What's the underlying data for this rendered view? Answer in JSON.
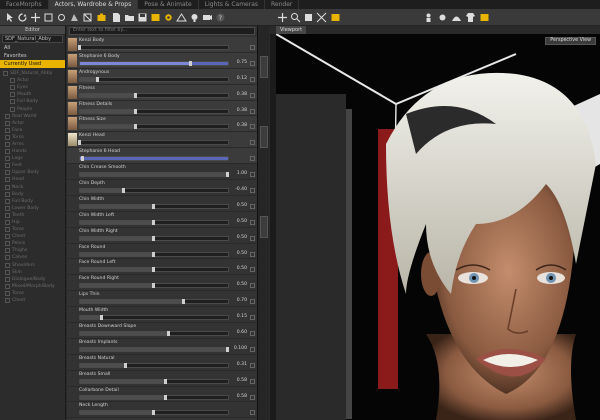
{
  "tabs": [
    "FaceMorphs",
    "Actors, Wardrobe & Props",
    "Pose & Animate",
    "Lights & Cameras",
    "Render"
  ],
  "active_tab": "Actors, Wardrobe & Props",
  "scene": {
    "header": "Editor",
    "selector": "SDF_Natural_Abby",
    "categories": [
      "All",
      "Favorites",
      "Currently Used"
    ],
    "selected_category": "Currently Used",
    "tree": [
      "SDF_Natural_Abby",
      "Actor",
      "Eyes",
      "Mouth",
      "Full Body",
      "People",
      "Real World",
      "Actor",
      "Face",
      "Torso",
      "Arms",
      "Hands",
      "Legs",
      "Feet",
      "Upper Body",
      "Head",
      "Neck",
      "Body",
      "Full Body",
      "Lower Body",
      "Teeth",
      "Hip",
      "Torso",
      "Chest",
      "Pelvis",
      "Thighs",
      "Calves",
      "Shoulders",
      "Skin",
      "Dialogue/Body",
      "Mixed/Morph/Body",
      "Torso",
      "Chest"
    ]
  },
  "params": {
    "search_placeholder": "Enter text to filter by...",
    "rows": [
      {
        "label": "Kenzi Body",
        "value": "",
        "fill": 0.0,
        "thumb": "brown",
        "highlight": false
      },
      {
        "label": "Stephanie 6 Body",
        "value": "0.75",
        "fill": 0.75,
        "thumb": "brown",
        "highlight": true
      },
      {
        "label": "Androgynous",
        "value": "0.12",
        "fill": 0.12,
        "thumb": "brown",
        "highlight": false
      },
      {
        "label": "Fitness",
        "value": "0.38",
        "fill": 0.38,
        "thumb": "brown",
        "highlight": false
      },
      {
        "label": "Fitness Details",
        "value": "0.38",
        "fill": 0.38,
        "thumb": "brown",
        "highlight": false
      },
      {
        "label": "Fitness Size",
        "value": "0.38",
        "fill": 0.38,
        "thumb": "brown",
        "highlight": false
      },
      {
        "label": "Kenzi Head",
        "value": "",
        "fill": 0.0,
        "thumb": "blond",
        "highlight": false
      },
      {
        "label": "Stephanie 6 Head",
        "value": "",
        "fill": 0.02,
        "thumb": "",
        "highlight": true
      },
      {
        "label": "Chin Crease Smooth",
        "value": "1.00",
        "fill": 1.0,
        "thumb": "",
        "highlight": false
      },
      {
        "label": "Chin Depth",
        "value": "-0.40",
        "fill": 0.3,
        "thumb": "",
        "highlight": false
      },
      {
        "label": "Chin Width",
        "value": "0.50",
        "fill": 0.5,
        "thumb": "",
        "highlight": false
      },
      {
        "label": "Chin Width Left",
        "value": "0.50",
        "fill": 0.5,
        "thumb": "",
        "highlight": false
      },
      {
        "label": "Chin Width Right",
        "value": "0.50",
        "fill": 0.5,
        "thumb": "",
        "highlight": false
      },
      {
        "label": "Face Round",
        "value": "0.50",
        "fill": 0.5,
        "thumb": "",
        "highlight": false
      },
      {
        "label": "Face Round Left",
        "value": "0.50",
        "fill": 0.5,
        "thumb": "",
        "highlight": false
      },
      {
        "label": "Face Round Right",
        "value": "0.50",
        "fill": 0.5,
        "thumb": "",
        "highlight": false
      },
      {
        "label": "Lips Thin",
        "value": "0.70",
        "fill": 0.7,
        "thumb": "",
        "highlight": false
      },
      {
        "label": "Mouth Width",
        "value": "0.15",
        "fill": 0.15,
        "thumb": "",
        "highlight": false
      },
      {
        "label": "Breasts Downward Slope",
        "value": "0.60",
        "fill": 0.6,
        "thumb": "",
        "highlight": false
      },
      {
        "label": "Breasts Implants",
        "value": "0.100",
        "fill": 1.0,
        "thumb": "",
        "highlight": false
      },
      {
        "label": "Breasts Natural",
        "value": "0.31",
        "fill": 0.31,
        "thumb": "",
        "highlight": false
      },
      {
        "label": "Breasts Small",
        "value": "0.58",
        "fill": 0.58,
        "thumb": "",
        "highlight": false
      },
      {
        "label": "Collarbone Detail",
        "value": "0.58",
        "fill": 0.58,
        "thumb": "",
        "highlight": false
      },
      {
        "label": "Neck Length",
        "value": "",
        "fill": 0.5,
        "thumb": "",
        "highlight": false
      }
    ]
  },
  "viewport": {
    "tab": "Viewport",
    "camera": "Perspective View"
  }
}
